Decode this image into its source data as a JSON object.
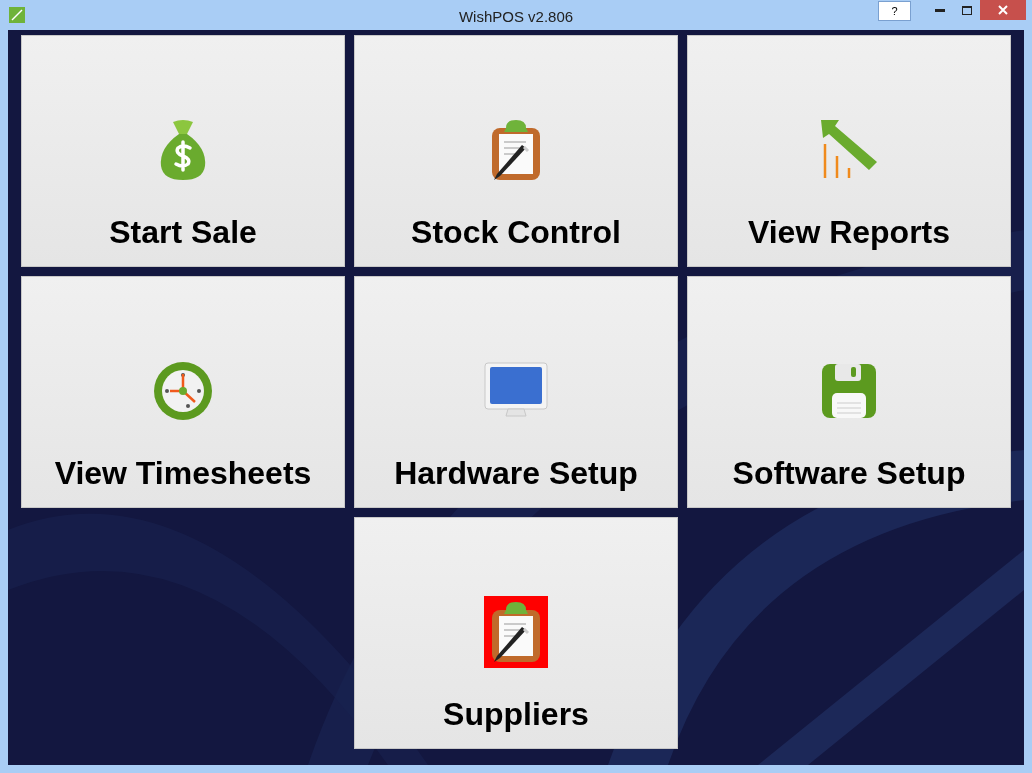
{
  "window": {
    "title": "WishPOS v2.806",
    "help": "?"
  },
  "tiles": [
    {
      "label": "Start Sale",
      "kind": "sale",
      "highlighted": false
    },
    {
      "label": "Stock Control",
      "kind": "stock",
      "highlighted": false
    },
    {
      "label": "View Reports",
      "kind": "reports",
      "highlighted": false
    },
    {
      "label": "View Timesheets",
      "kind": "timesheets",
      "highlighted": false
    },
    {
      "label": "Hardware Setup",
      "kind": "hardware",
      "highlighted": false
    },
    {
      "label": "Software Setup",
      "kind": "software",
      "highlighted": false
    },
    {
      "label": "Suppliers",
      "kind": "suppliers",
      "highlighted": true
    }
  ]
}
